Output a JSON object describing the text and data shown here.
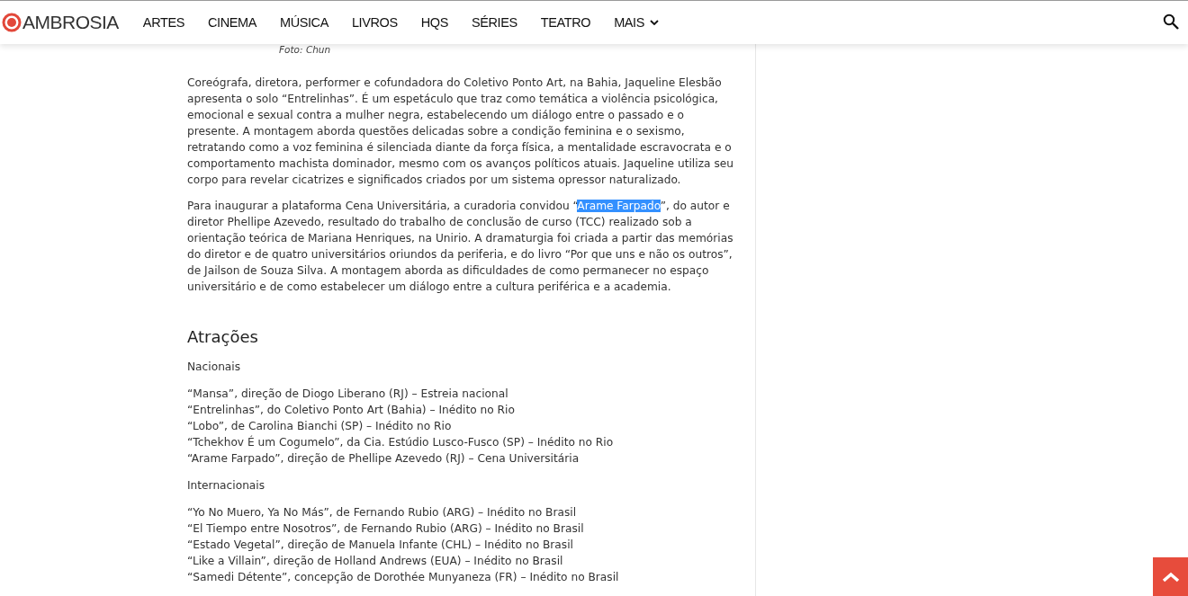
{
  "header": {
    "logo": "AMBROSIA",
    "nav": [
      {
        "label": "ARTES",
        "has_menu": false
      },
      {
        "label": "CINEMA",
        "has_menu": false
      },
      {
        "label": "MÚSICA",
        "has_menu": false
      },
      {
        "label": "LIVROS",
        "has_menu": false
      },
      {
        "label": "HQS",
        "has_menu": false
      },
      {
        "label": "SÉRIES",
        "has_menu": false
      },
      {
        "label": "TEATRO",
        "has_menu": false
      },
      {
        "label": "MAIS",
        "has_menu": true
      }
    ]
  },
  "article": {
    "photo_caption": "Foto: Chun",
    "paragraphs": [
      [
        {
          "text": "Coreógrafa, diretora, performer e cofundadora do Coletivo Ponto Art, na Bahia, Jaqueline Elesbão apresenta o solo “Entrelinhas”. É um espetáculo que traz como temática a violência psicológica, emocional e sexual contra a mulher negra, estabelecendo um diálogo entre o passado e o presente. A montagem aborda questões delicadas sobre a condição feminina e o sexismo, retratando como a voz feminina é silenciada diante da força física, a mentalidade escravocrata e o comportamento machista dominador, mesmo com os avanços políticos atuais. Jaqueline utiliza seu corpo para revelar cicatrizes e significados criados por um sistema opressor naturalizado.",
          "selected": false
        }
      ],
      [
        {
          "text": "Para inaugurar a plataforma Cena Universitária, a curadoria convidou “",
          "selected": false
        },
        {
          "text": "Arame Farpado",
          "selected": true
        },
        {
          "text": "”, do autor e diretor Phellipe Azevedo, resultado do trabalho de conclusão de curso (TCC) realizado sob a orientação teórica de Mariana Henriques, na Unirio. A dramaturgia foi criada a partir das memórias do diretor e de quatro universitários oriundos da periferia, e do livro “Por que uns e não os outros”, de Jailson de Souza Silva. A montagem aborda as dificuldades de como permanecer no espaço universitário e de como estabelecer um diálogo entre a cultura periférica e a academia.",
          "selected": false
        }
      ]
    ],
    "heading": "Atrações",
    "groups": [
      {
        "title": "Nacionais",
        "items": [
          "“Mansa”, direção de Diogo Liberano (RJ) – Estreia nacional",
          "“Entrelinhas”, do Coletivo Ponto Art (Bahia) – Inédito no Rio",
          "“Lobo”, de Carolina Bianchi (SP) – Inédito no Rio",
          "“Tchekhov É um Cogumelo”, da Cia. Estúdio Lusco-Fusco (SP) – Inédito no Rio",
          "“Arame Farpado”, direção de Phellipe Azevedo (RJ) – Cena Universitária"
        ]
      },
      {
        "title": "Internacionais",
        "items": [
          "“Yo No Muero, Ya No Más”, de Fernando Rubio (ARG) – Inédito no Brasil",
          "“El Tiempo entre Nosotros”, de Fernando Rubio (ARG) – Inédito no Brasil",
          "“Estado Vegetal”, direção de Manuela Infante (CHL) – Inédito no Brasil",
          "“Like a Villain”, direção de Holland Andrews (EUA) – Inédito no Brasil",
          "“Samedi Détente”, concepção de Dorothée Munyaneza (FR) – Inédito no Brasil"
        ]
      }
    ]
  }
}
